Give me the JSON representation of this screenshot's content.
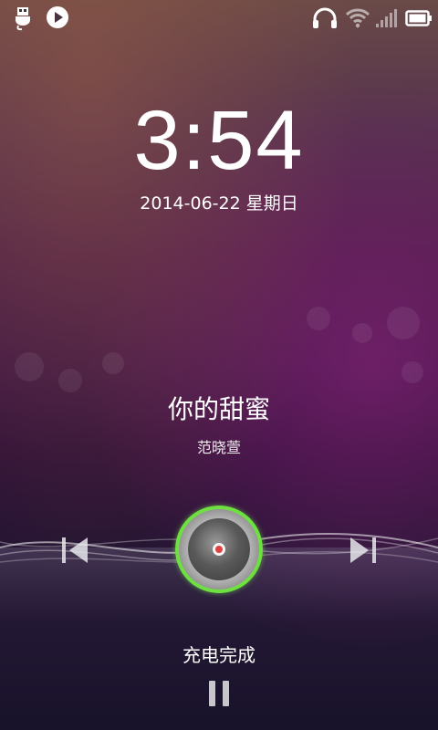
{
  "status_bar": {
    "left_icons": [
      "usb-debug-icon",
      "play-icon"
    ],
    "right_icons": [
      "headphones-icon",
      "wifi-icon",
      "signal-icon",
      "battery-icon"
    ]
  },
  "clock": {
    "time": "3:54",
    "date": "2014-06-22 星期日"
  },
  "music": {
    "title": "你的甜蜜",
    "artist": "范晓萱",
    "controls": [
      "previous-icon",
      "play-disc-button",
      "next-icon"
    ]
  },
  "charging": {
    "status": "充电完成"
  },
  "colors": {
    "accent_ring": "#6ee040",
    "text": "#ffffff"
  }
}
